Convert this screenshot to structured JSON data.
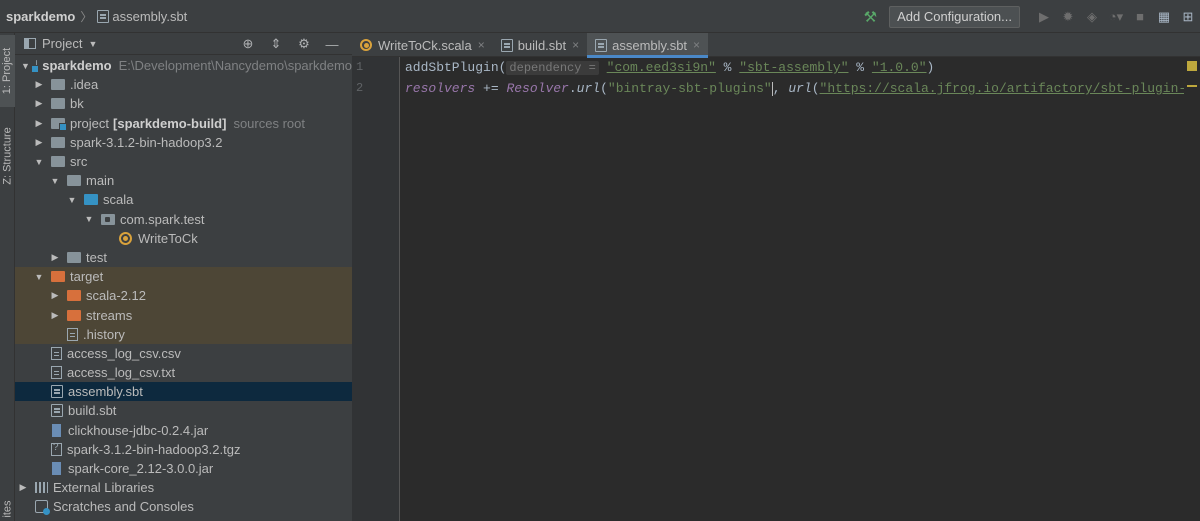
{
  "breadcrumb": {
    "project": "sparkdemo",
    "file": "assembly.sbt"
  },
  "toolbar": {
    "add_configuration": "Add Configuration..."
  },
  "left_strip": {
    "project_tab": "1: Project",
    "structure_tab": "Z: Structure",
    "favorites_tab": "ites"
  },
  "project_panel": {
    "title": "Project",
    "tree": [
      {
        "label": "sparkdemo",
        "hint": "E:\\Development\\Nancydemo\\sparkdemo"
      },
      {
        "label": ".idea"
      },
      {
        "label": "bk"
      },
      {
        "label": "project",
        "bold_part": "[sparkdemo-build]",
        "hint": "sources root"
      },
      {
        "label": "spark-3.1.2-bin-hadoop3.2"
      },
      {
        "label": "src"
      },
      {
        "label": "main"
      },
      {
        "label": "scala"
      },
      {
        "label": "com.spark.test"
      },
      {
        "label": "WriteToCk"
      },
      {
        "label": "test"
      },
      {
        "label": "target"
      },
      {
        "label": "scala-2.12"
      },
      {
        "label": "streams"
      },
      {
        "label": ".history"
      },
      {
        "label": "access_log_csv.csv"
      },
      {
        "label": "access_log_csv.txt"
      },
      {
        "label": "assembly.sbt"
      },
      {
        "label": "build.sbt"
      },
      {
        "label": "clickhouse-jdbc-0.2.4.jar"
      },
      {
        "label": "spark-3.1.2-bin-hadoop3.2.tgz"
      },
      {
        "label": "spark-core_2.12-3.0.0.jar"
      },
      {
        "label": "External Libraries"
      },
      {
        "label": "Scratches and Consoles"
      }
    ]
  },
  "editor": {
    "tabs": [
      {
        "label": "WriteToCk.scala"
      },
      {
        "label": "build.sbt"
      },
      {
        "label": "assembly.sbt"
      }
    ],
    "line_numbers": [
      "1",
      "2"
    ],
    "line1": {
      "fn": "addSbtPlugin(",
      "hint": "dependency =",
      "s1": "\"com.eed3si9n\"",
      "op1": " % ",
      "s2": "\"sbt-assembly\"",
      "op2": " % ",
      "s3": "\"1.0.0\"",
      "close": ")"
    },
    "line2": {
      "kw": "resolvers",
      "op": " += ",
      "obj": "Resolver",
      "dot": ".",
      "m1": "url",
      "p1": "(",
      "s1": "\"bintray-sbt-plugins\"",
      "comma": ", ",
      "m2": "url",
      "p2": "(",
      "s2": "\"https://scala.jfrog.io/artifactory/sbt-plugin-rele"
    }
  },
  "colors": {
    "accent": "#4a88c7",
    "selection": "#0d293e",
    "excluded": "#4d4636",
    "string": "#6a8759",
    "keyword_purple": "#9876aa"
  }
}
